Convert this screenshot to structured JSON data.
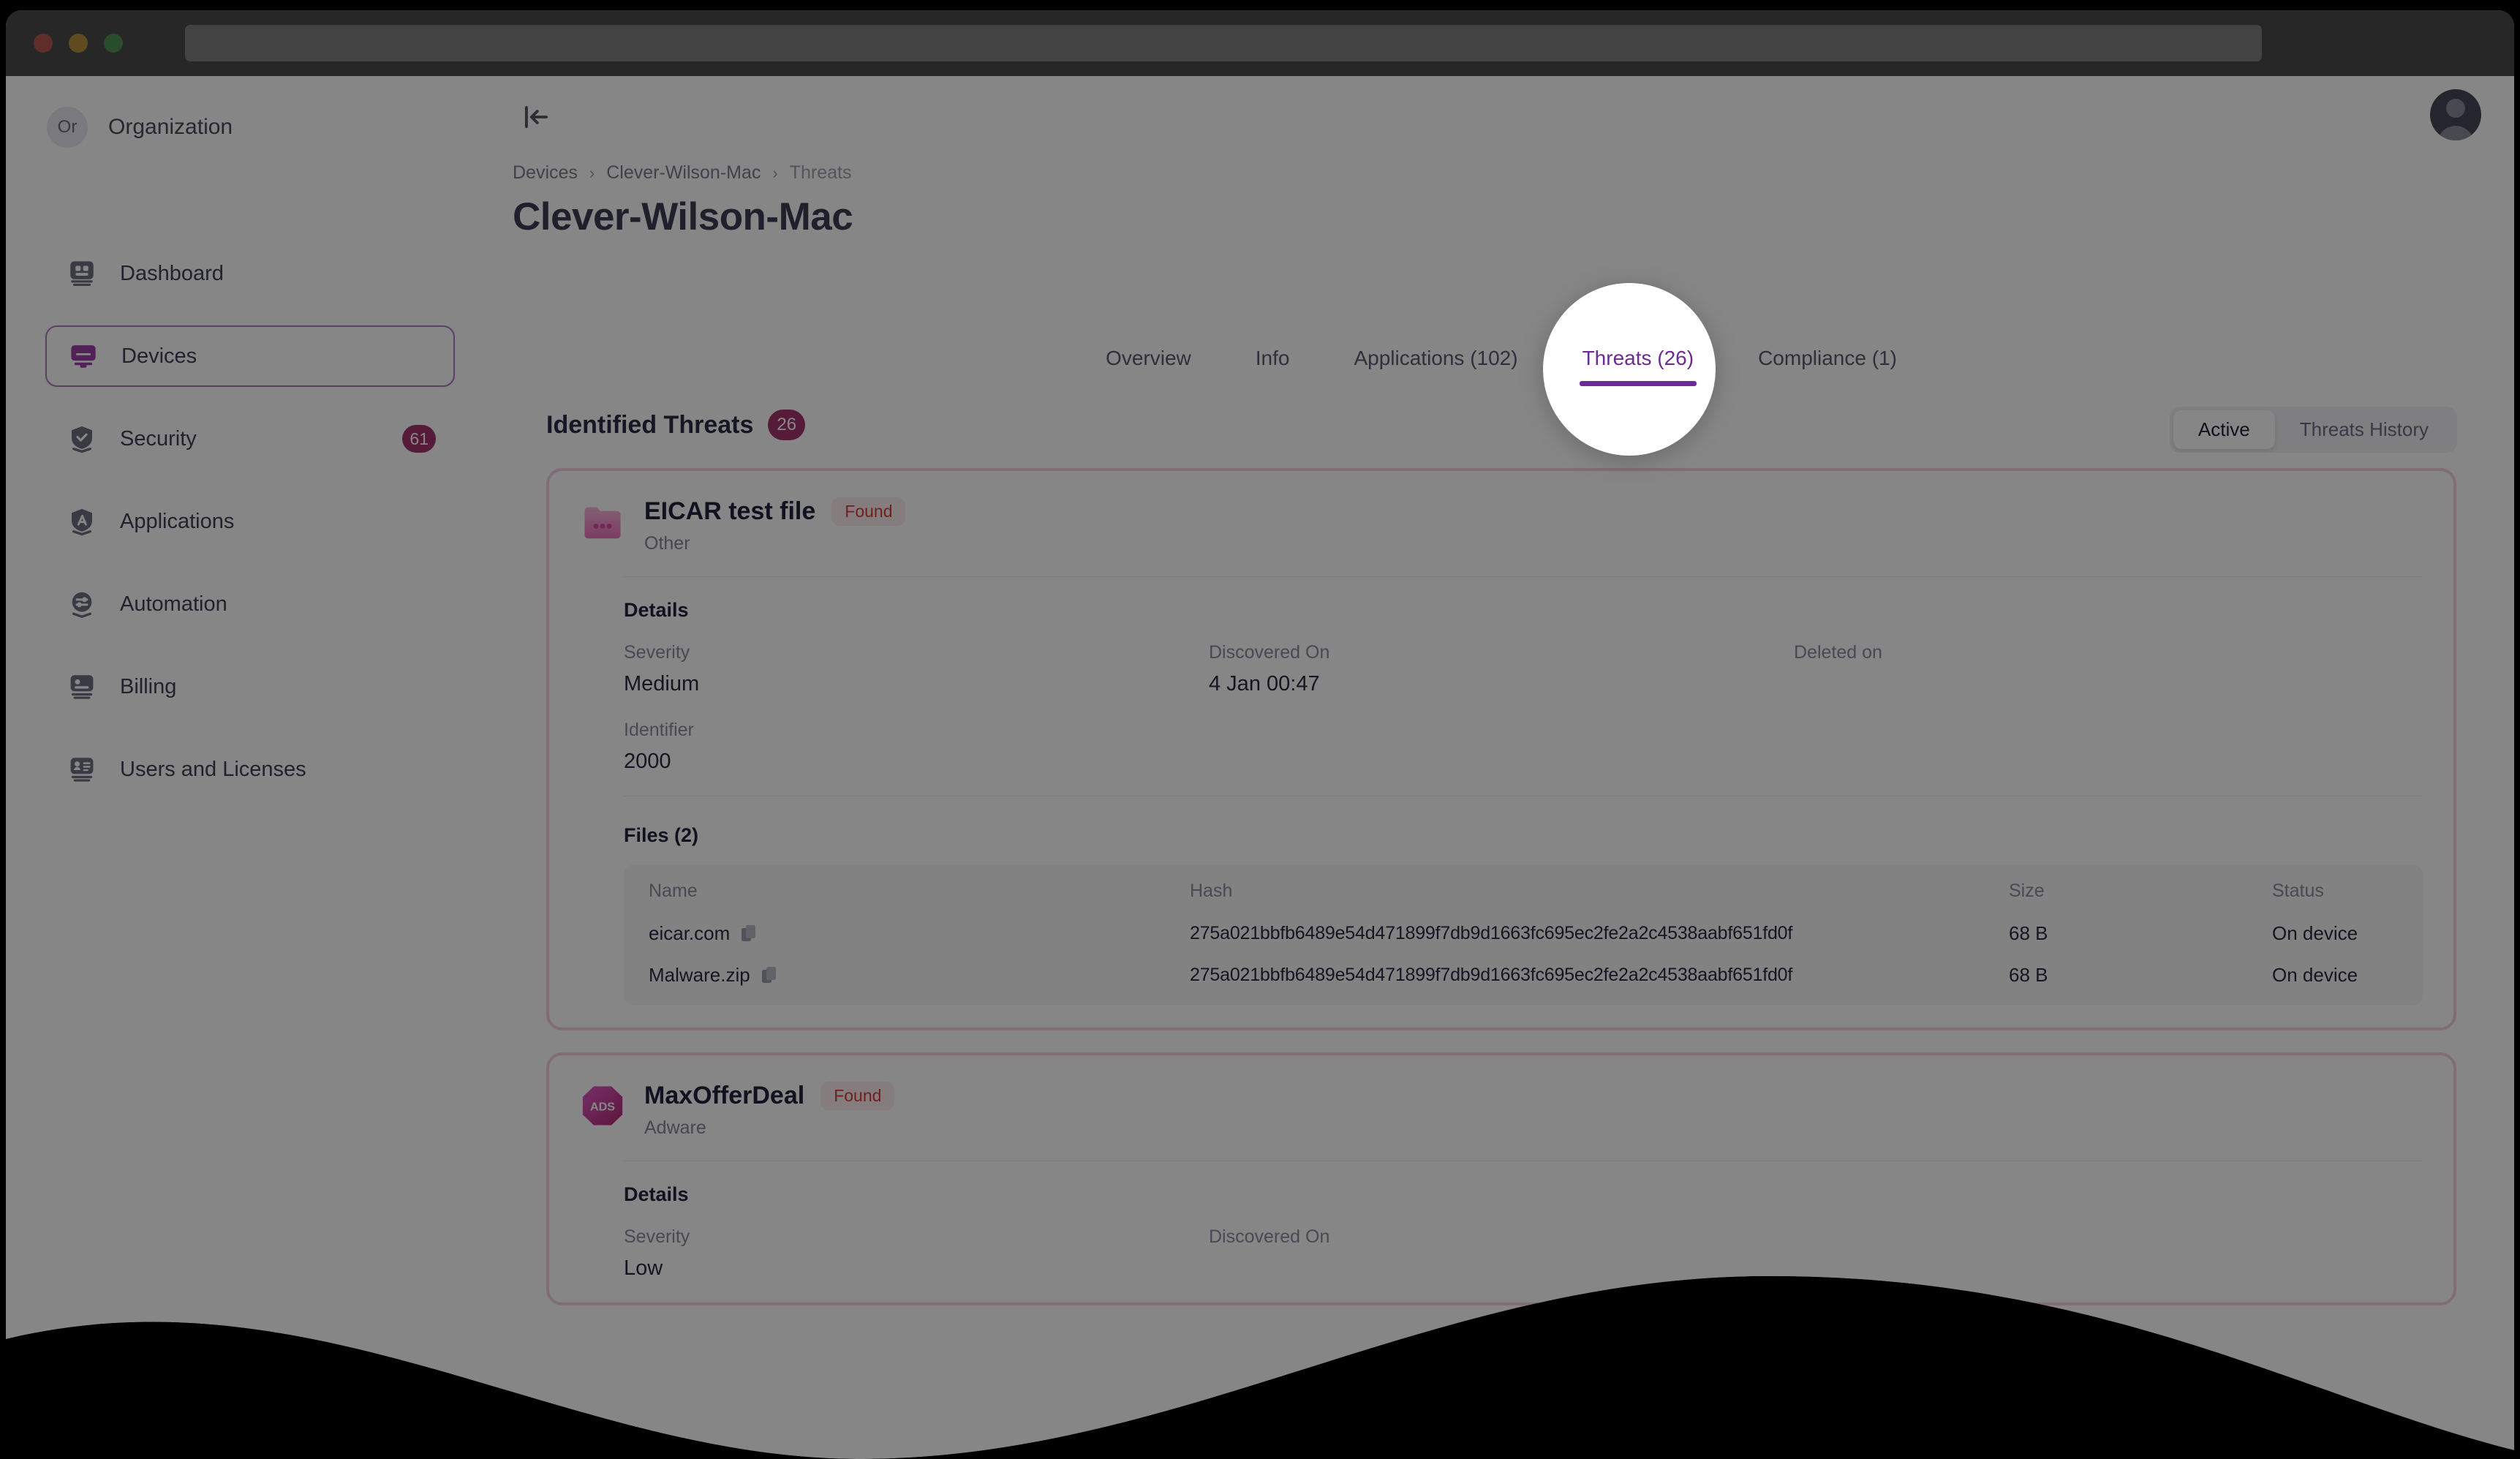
{
  "window": {
    "traffic_lights": [
      "close",
      "minimize",
      "maximize"
    ],
    "url_value": ""
  },
  "sidebar": {
    "org": {
      "initials": "Or",
      "name": "Organization"
    },
    "items": [
      {
        "label": "Dashboard",
        "icon": "dashboard-icon",
        "badge": "",
        "active": false
      },
      {
        "label": "Devices",
        "icon": "devices-icon",
        "badge": "",
        "active": true
      },
      {
        "label": "Security",
        "icon": "shield-check-icon",
        "badge": "61",
        "active": false
      },
      {
        "label": "Applications",
        "icon": "applications-icon",
        "badge": "",
        "active": false
      },
      {
        "label": "Automation",
        "icon": "automation-icon",
        "badge": "",
        "active": false
      },
      {
        "label": "Billing",
        "icon": "billing-icon",
        "badge": "",
        "active": false
      },
      {
        "label": "Users and Licenses",
        "icon": "users-licenses-icon",
        "badge": "",
        "active": false
      }
    ]
  },
  "topbar": {
    "collapse_icon": "collapse-sidebar-icon",
    "avatar_icon": "user-avatar-icon"
  },
  "breadcrumb": [
    {
      "label": "Devices",
      "current": false
    },
    {
      "label": "Clever-Wilson-Mac",
      "current": false
    },
    {
      "label": "Threats",
      "current": true
    }
  ],
  "page": {
    "title": "Clever-Wilson-Mac"
  },
  "tabs": [
    {
      "label": "Overview",
      "active": false
    },
    {
      "label": "Info",
      "active": false
    },
    {
      "label": "Applications (102)",
      "active": false
    },
    {
      "label": "Threats (26)",
      "active": true
    },
    {
      "label": "Compliance (1)",
      "active": false
    }
  ],
  "content": {
    "heading": "Identified Threats",
    "count": "26",
    "view_toggle": [
      {
        "label": "Active",
        "selected": true
      },
      {
        "label": "Threats History",
        "selected": false
      }
    ]
  },
  "threats": [
    {
      "name": "EICAR test file",
      "status": "Found",
      "category": "Other",
      "icon": "folder-threat-icon",
      "icon_label": "",
      "details_label": "Details",
      "details": [
        {
          "key": "Severity",
          "value": "Medium"
        },
        {
          "key": "Discovered On",
          "value": "4 Jan 00:47"
        },
        {
          "key": "Deleted on",
          "value": ""
        },
        {
          "key": "Identifier",
          "value": "2000"
        }
      ],
      "files_label": "Files (2)",
      "files_columns": [
        "Name",
        "Hash",
        "Size",
        "Status"
      ],
      "files": [
        {
          "name": "eicar.com",
          "hash": "275a021bbfb6489e54d471899f7db9d1663fc695ec2fe2a2c4538aabf651fd0f",
          "size": "68 B",
          "status": "On device"
        },
        {
          "name": "Malware.zip",
          "hash": "275a021bbfb6489e54d471899f7db9d1663fc695ec2fe2a2c4538aabf651fd0f",
          "size": "68 B",
          "status": "On device"
        }
      ]
    },
    {
      "name": "MaxOfferDeal",
      "status": "Found",
      "category": "Adware",
      "icon": "adware-badge-icon",
      "icon_label": "ADS",
      "details_label": "Details",
      "details": [
        {
          "key": "Severity",
          "value": "Low"
        },
        {
          "key": "Discovered On",
          "value": ""
        }
      ]
    }
  ],
  "colors": {
    "accent_purple": "#6d2b93",
    "badge_magenta": "#a4346c",
    "threat_border_pink": "#f6cfe4",
    "status_found_text": "#d63b3b",
    "status_found_bg": "#fdeeee",
    "titlebar": "#4a4a4a",
    "text_primary": "#22223e",
    "text_muted": "#8b8ba0"
  }
}
